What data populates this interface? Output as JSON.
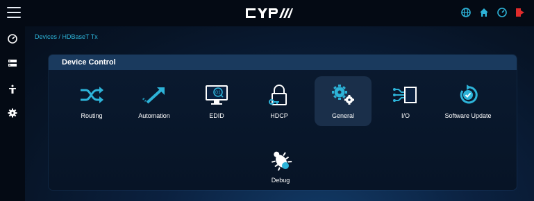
{
  "header": {
    "logo_text": "CYP",
    "icons": [
      "globe-icon",
      "home-icon",
      "dashboard-icon",
      "logout-icon"
    ]
  },
  "sidebar": {
    "items": [
      "dashboard-icon",
      "devices-icon",
      "accessibility-icon",
      "settings-icon"
    ]
  },
  "breadcrumb": "Devices / HDBaseT Tx",
  "panel": {
    "title": "Device Control",
    "tiles": [
      {
        "label": "Routing",
        "icon": "routing-icon",
        "active": false
      },
      {
        "label": "Automation",
        "icon": "automation-icon",
        "active": false
      },
      {
        "label": "EDID",
        "icon": "edid-icon",
        "active": false
      },
      {
        "label": "HDCP",
        "icon": "hdcp-icon",
        "active": false
      },
      {
        "label": "General",
        "icon": "general-icon",
        "active": true
      },
      {
        "label": "I/O",
        "icon": "io-icon",
        "active": false
      },
      {
        "label": "Software Update",
        "icon": "software-update-icon",
        "active": false
      },
      {
        "label": "Debug",
        "icon": "debug-icon",
        "active": false
      }
    ]
  },
  "colors": {
    "accent": "#2db3d8",
    "logout": "#e02b2b",
    "active_tile": "#1a2f4a"
  }
}
